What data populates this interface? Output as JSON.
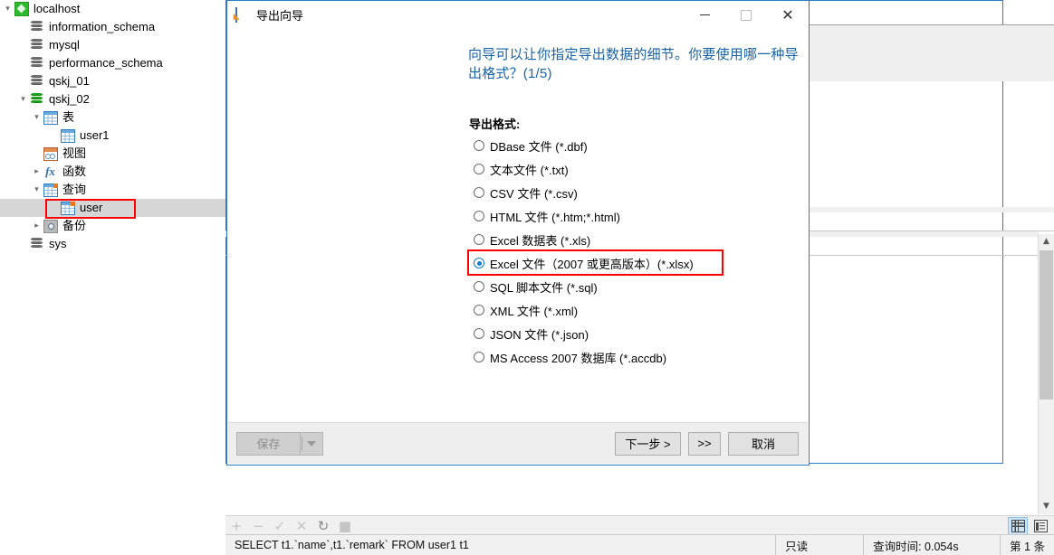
{
  "sidebar": {
    "items": [
      {
        "label": "localhost",
        "icon": "host-icon",
        "indent": 0,
        "twisty": "v",
        "selected": false
      },
      {
        "label": "information_schema",
        "icon": "database-icon",
        "indent": 1,
        "twisty": "",
        "selected": false
      },
      {
        "label": "mysql",
        "icon": "database-icon",
        "indent": 1,
        "twisty": "",
        "selected": false
      },
      {
        "label": "performance_schema",
        "icon": "database-icon",
        "indent": 1,
        "twisty": "",
        "selected": false
      },
      {
        "label": "qskj_01",
        "icon": "database-icon",
        "indent": 1,
        "twisty": "",
        "selected": false
      },
      {
        "label": "qskj_02",
        "icon": "database-open-icon",
        "indent": 1,
        "twisty": "v",
        "selected": false
      },
      {
        "label": "表",
        "icon": "table-icon",
        "indent": 2,
        "twisty": "v",
        "selected": false
      },
      {
        "label": "user1",
        "icon": "table-icon",
        "indent": 3,
        "twisty": "",
        "selected": false
      },
      {
        "label": "视图",
        "icon": "view-icon",
        "indent": 2,
        "twisty": "",
        "selected": false
      },
      {
        "label": "函数",
        "icon": "function-icon",
        "indent": 2,
        "twisty": ">",
        "selected": false
      },
      {
        "label": "查询",
        "icon": "query-icon",
        "indent": 2,
        "twisty": "v",
        "selected": false
      },
      {
        "label": "user",
        "icon": "query-icon",
        "indent": 3,
        "twisty": "",
        "selected": true
      },
      {
        "label": "备份",
        "icon": "backup-icon",
        "indent": 2,
        "twisty": ">",
        "selected": false
      },
      {
        "label": "sys",
        "icon": "database-icon",
        "indent": 1,
        "twisty": "",
        "selected": false
      }
    ]
  },
  "dialog": {
    "title": "导出向导",
    "icon": "export-wizard-icon",
    "header": "向导可以让你指定导出数据的细节。你要使用哪一种导出格式？(1/5)",
    "format_label": "导出格式:",
    "options": [
      {
        "label": "DBase 文件 (*.dbf)",
        "checked": false
      },
      {
        "label": "文本文件 (*.txt)",
        "checked": false
      },
      {
        "label": "CSV 文件 (*.csv)",
        "checked": false
      },
      {
        "label": "HTML 文件 (*.htm;*.html)",
        "checked": false
      },
      {
        "label": "Excel 数据表 (*.xls)",
        "checked": false
      },
      {
        "label": "Excel 文件（2007 或更高版本）(*.xlsx)",
        "checked": true
      },
      {
        "label": "SQL 脚本文件 (*.sql)",
        "checked": false
      },
      {
        "label": "XML 文件 (*.xml)",
        "checked": false
      },
      {
        "label": "JSON 文件 (*.json)",
        "checked": false
      },
      {
        "label": "MS Access 2007 数据库 (*.accdb)",
        "checked": false
      }
    ],
    "footer": {
      "save_label": "保存",
      "next_label": "下一步 >",
      "fast_forward_label": ">>",
      "cancel_label": "取消"
    },
    "window_controls": {
      "minimize": "minimize-icon",
      "maximize": "maximize-icon",
      "close": "close-icon"
    }
  },
  "bottom_toolbar": {
    "icons": [
      "add-icon",
      "remove-icon",
      "confirm-icon",
      "cancel-edit-icon",
      "refresh-icon",
      "stop-icon"
    ],
    "glyphs": [
      "+",
      "−",
      "✓",
      "✕",
      "↻",
      "■"
    ],
    "view_toggle": {
      "grid": "grid-view-icon",
      "form": "form-view-icon",
      "active": "grid"
    }
  },
  "statusbar": {
    "sql": "SELECT t1.`name`,t1.`remark` FROM user1 t1",
    "readonly": "只读",
    "query_time": "查询时间: 0.054s",
    "record": "第 1 条"
  },
  "colors": {
    "accent": "#2b7cc4",
    "header_text": "#1763a6",
    "highlight_red": "#ff0000",
    "radio_blue": "#0a7cd4",
    "selection_gray": "#d6d6d6"
  }
}
